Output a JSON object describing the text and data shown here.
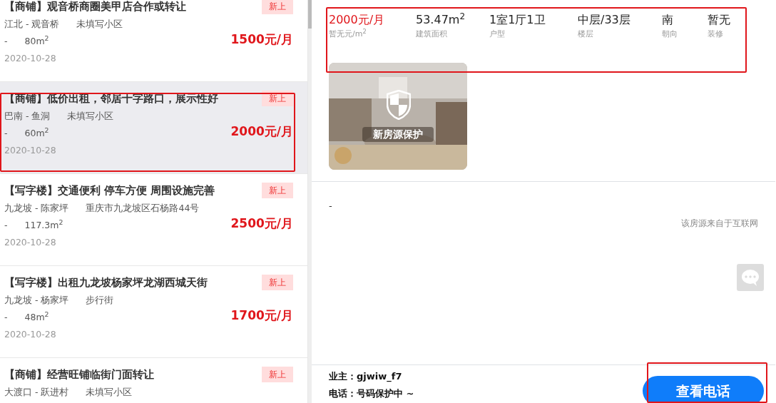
{
  "listings": [
    {
      "title": "【商铺】观音桥商圈美甲店合作或转让",
      "badge": "新上",
      "location": "江北 - 观音桥",
      "community": "未填写小区",
      "floor": "-",
      "area": "80m$^{2}$",
      "price": "1500元/月",
      "date": "2020-10-28",
      "selected": false
    },
    {
      "title": "【商铺】低价出租，邻居十字路口，展示性好",
      "badge": "新上",
      "location": "巴南 - 鱼洞",
      "community": "未填写小区",
      "floor": "-",
      "area": "60m$^{2}$",
      "price": "2000元/月",
      "date": "2020-10-28",
      "selected": true
    },
    {
      "title": "【写字楼】交通便利 停车方便 周围设施完善",
      "badge": "新上",
      "location": "九龙坡 - 陈家坪",
      "community": "重庆市九龙坡区石杨路44号",
      "floor": "-",
      "area": "117.3m$^{2}$",
      "price": "2500元/月",
      "date": "2020-10-28",
      "selected": false
    },
    {
      "title": "【写字楼】出租九龙坡杨家坪龙湖西城天街",
      "badge": "新上",
      "location": "九龙坡 - 杨家坪",
      "community": "步行街",
      "floor": "-",
      "area": "48m$^{2}$",
      "price": "1700元/月",
      "date": "2020-10-28",
      "selected": false
    },
    {
      "title": "【商铺】经营旺铺临街门面转让",
      "badge": "新上",
      "location": "大渡口 - 跃进村",
      "community": "未填写小区",
      "selected": false
    }
  ],
  "stats": [
    {
      "kind": "price",
      "value": "2000元/月",
      "label": "暂无元/m$^{2}$"
    },
    {
      "kind": "plain",
      "value": "53.47m$^{2}$",
      "label": "建筑面积"
    },
    {
      "kind": "plain",
      "value": "1室1厅1卫",
      "label": "户型"
    },
    {
      "kind": "plain",
      "value": "中层/33层",
      "label": "楼层"
    },
    {
      "kind": "plain",
      "value": "南",
      "label": "朝向"
    },
    {
      "kind": "plain",
      "value": "暂无",
      "label": "装修"
    }
  ],
  "photo": {
    "kind": "picture",
    "caption": "新房源保护"
  },
  "description": "-",
  "source_note": "该房源来自于互联网",
  "owner": "业主：gjwiw_f7",
  "phone": "电话：号码保护中 ~",
  "call_button": "查看电话"
}
